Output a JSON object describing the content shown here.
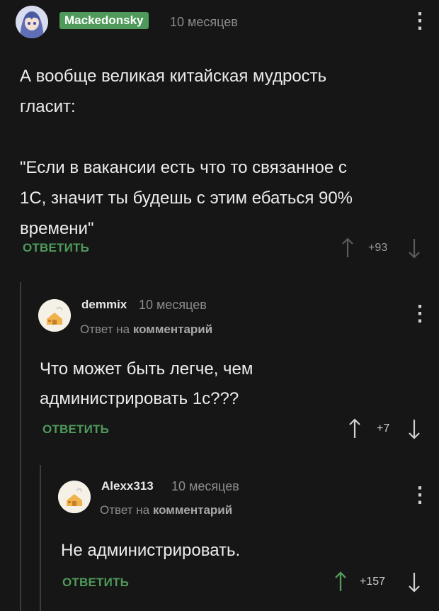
{
  "comments": [
    {
      "username": "Mackedonsky",
      "time": "10 месяцев",
      "text_lines": [
        "А вообще великая китайская мудрость",
        "гласит:",
        "",
        "\"Если в вакансии есть что то связанное с",
        "1С, значит ты будешь с этим ебаться 90%",
        "времени\""
      ],
      "reply_label": "ОТВЕТИТЬ",
      "votes": "+93"
    },
    {
      "username": "demmix",
      "time": "10 месяцев",
      "reply_to_prefix": "Ответ на",
      "reply_to_target": "комментарий",
      "text_lines": [
        "Что может быть легче, чем",
        "администрировать 1с???"
      ],
      "reply_label": "ОТВЕТИТЬ",
      "votes": "+7"
    },
    {
      "username": "Alexx313",
      "time": "10 месяцев",
      "reply_to_prefix": "Ответ на",
      "reply_to_target": "комментарий",
      "text_lines": [
        "Не администрировать."
      ],
      "reply_label": "ОТВЕТИТЬ",
      "votes": "+157"
    }
  ],
  "colors": {
    "accent": "#4f9a5b",
    "upvoted": "#4f9a5b"
  },
  "icons": [
    "avatar-anime",
    "avatar-default-house",
    "kebab-menu-icon",
    "arrow-up-icon",
    "arrow-down-icon"
  ]
}
